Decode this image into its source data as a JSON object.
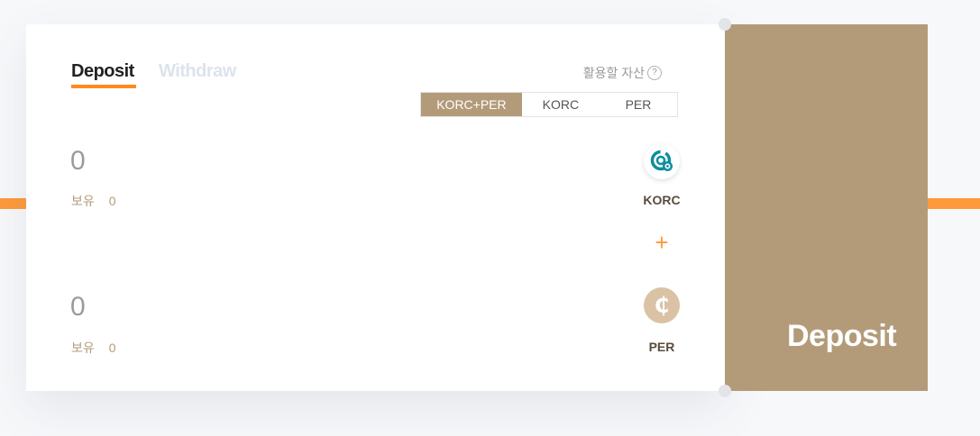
{
  "tabs": {
    "deposit_label": "Deposit",
    "withdraw_label": "Withdraw"
  },
  "asset_selector": {
    "label": "활용할 자산",
    "help_symbol": "?",
    "options": [
      "KORC+PER",
      "KORC",
      "PER"
    ],
    "selected": "KORC+PER"
  },
  "korc": {
    "amount": "0",
    "hold_label": "보유",
    "hold_value": "0",
    "name": "KORC"
  },
  "operator": "+",
  "per": {
    "amount": "0",
    "hold_label": "보유",
    "hold_value": "0",
    "name": "PER",
    "symbol": "₵"
  },
  "action": {
    "label": "Deposit"
  },
  "colors": {
    "accent_orange": "#ff8a1d",
    "brand_tan": "#b39b7a",
    "per_coin": "#dac2a4",
    "korc_teal": "#0e8e9e"
  }
}
